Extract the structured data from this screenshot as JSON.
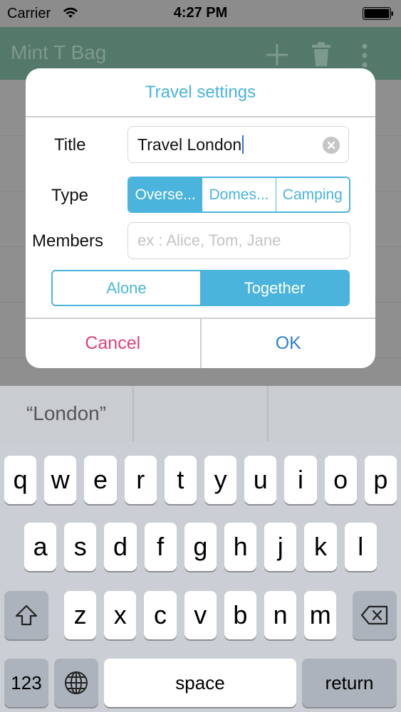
{
  "status_bar": {
    "carrier": "Carrier",
    "time": "4:27 PM"
  },
  "app": {
    "title": "Mint T Bag",
    "icons": [
      "plus-icon",
      "trash-icon",
      "more-icon"
    ]
  },
  "dialog": {
    "title": "Travel settings",
    "title_label": "Title",
    "title_value": "Travel London",
    "type_label": "Type",
    "type_options": [
      "Overse...",
      "Domes...",
      "Camping"
    ],
    "type_selected": "Overse...",
    "members_label": "Members",
    "members_placeholder": "ex : Alice, Tom, Jane",
    "mode_options": [
      "Alone",
      "Together"
    ],
    "mode_selected": "Together",
    "cancel_label": "Cancel",
    "ok_label": "OK"
  },
  "suggestions": [
    "“London”",
    "",
    ""
  ],
  "keyboard": {
    "row1": [
      "q",
      "w",
      "e",
      "r",
      "t",
      "y",
      "u",
      "i",
      "o",
      "p"
    ],
    "row2": [
      "a",
      "s",
      "d",
      "f",
      "g",
      "h",
      "j",
      "k",
      "l"
    ],
    "row3": [
      "z",
      "x",
      "c",
      "v",
      "b",
      "n",
      "m"
    ],
    "numbers_label": "123",
    "space_label": "space",
    "return_label": "return",
    "icons": [
      "shift-icon",
      "backspace-icon",
      "globe-icon"
    ]
  },
  "colors": {
    "accent": "#4ab4dc",
    "cancel": "#e0407a",
    "ok": "#2f7fcf",
    "navbar": "#54786a"
  }
}
